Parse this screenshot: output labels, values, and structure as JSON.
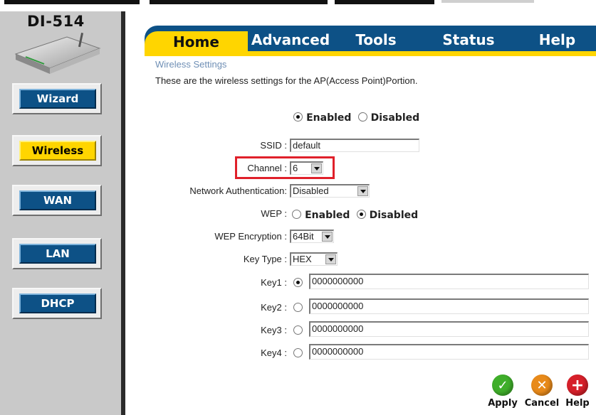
{
  "device": {
    "model": "DI-514"
  },
  "sidebar": {
    "items": [
      {
        "label": "Wizard"
      },
      {
        "label": "Wireless"
      },
      {
        "label": "WAN"
      },
      {
        "label": "LAN"
      },
      {
        "label": "DHCP"
      }
    ],
    "active": "Wireless"
  },
  "tabs": [
    {
      "label": "Home"
    },
    {
      "label": "Advanced"
    },
    {
      "label": "Tools"
    },
    {
      "label": "Status"
    },
    {
      "label": "Help"
    }
  ],
  "wireless": {
    "section_title": "Wireless Settings",
    "description": "These are the wireless settings for the AP(Access Point)Portion.",
    "enabled_label": "Enabled",
    "disabled_label": "Disabled",
    "wireless_state": "Enabled",
    "ssid_label": "SSID :",
    "ssid_value": "default",
    "channel_label": "Channel :",
    "channel_value": "6",
    "auth_label": "Network Authentication:",
    "auth_value": "Disabled",
    "wep_label": "WEP :",
    "wep_state": "Disabled",
    "wep_encryption_label": "WEP Encryption :",
    "wep_encryption_value": "64Bit",
    "key_type_label": "Key Type :",
    "key_type_value": "HEX",
    "keys": [
      {
        "label": "Key1 :",
        "value": "0000000000",
        "selected": true
      },
      {
        "label": "Key2 :",
        "value": "0000000000",
        "selected": false
      },
      {
        "label": "Key3 :",
        "value": "0000000000",
        "selected": false
      },
      {
        "label": "Key4 :",
        "value": "0000000000",
        "selected": false
      }
    ]
  },
  "actions": {
    "apply_label": "Apply",
    "cancel_label": "Cancel",
    "help_label": "Help"
  },
  "colors": {
    "nav_blue": "#0d5186",
    "accent_yellow": "#ffd500",
    "highlight_red": "#e0202a"
  }
}
